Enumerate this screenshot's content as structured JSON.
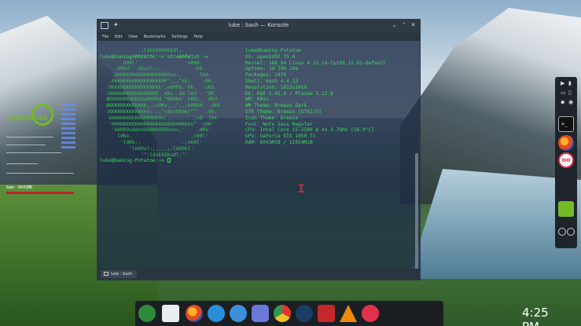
{
  "window": {
    "title": "luke : bash — Konsole",
    "menu": [
      "File",
      "Edit",
      "View",
      "Bookmarks",
      "Settings",
      "Help"
    ],
    "tab_label": "luke : bash"
  },
  "terminal": {
    "command_line": "luke@Gaming-Potatoe:~> screenfetch -w",
    "final_prompt": "luke@Gaming-Potatoe:~> ",
    "logo_lines": [
      "             .;ldkO0000Okdl;.",
      "         .;d00xl:^''''''^:ok00d;.",
      "       .d00l'                'o00d.",
      "     .d0Kd'  Okxol:;,.          :00.",
      "    .OKKKK0kOKKKKKKKKKKOxo:,      lKO.",
      "   ,0KKKKKKKKKKKKKKKK0P^,,,^dx:    ;00,",
      "  .OKKKKKKKKKKKKKKKKk'.oOPPb.'0k.   cKO.",
      "  :KKKKKKKKKKKKKKKKK: kKx..dd lKd   'OK:",
      "  dKKKKKKKKKKKOx0KKKd ^0KKKO' kKKc   dKd",
      "  dKKKKKKKKKKKKK;.;oOKx,,,^..;kKKK0.  dKd",
      "  :KKKKKKKKKKKK0o;...^cdxxOK0O/^^'  .0K:",
      "   kKKKKKKKKKKKKKKKK0x;,,......,;od  lKk",
      "   '0KKKKKKKKKKKKKKKKKKKKK00KKOo^  c00'",
      "    'kKKKOxddxkOO00000Okxoc;''   .dKk'",
      "      l0Ko.                    .c00l'",
      "       'l0Kk:.              .;xK0l'",
      "          'lkK0xl:;,,,,;:ldO0kl'",
      "              '^:ldxkkkkxdl:^'"
    ],
    "info": [
      {
        "key": "",
        "value": "luke@Gaming-Potatoe"
      },
      {
        "key": "OS:",
        "value": "openSUSE 15.0"
      },
      {
        "key": "Kernel:",
        "value": "x86_64 Linux 4.12.14-lp150.12.61-default"
      },
      {
        "key": "Uptime:",
        "value": "1d 19h 10m"
      },
      {
        "key": "Packages:",
        "value": "2870"
      },
      {
        "key": "Shell:",
        "value": "bash 4.4.23"
      },
      {
        "key": "Resolution:",
        "value": "1812x1019"
      },
      {
        "key": "DE:",
        "value": "KDE 5.45.0 / Plasma 5.12.8"
      },
      {
        "key": "WM:",
        "value": "KWin"
      },
      {
        "key": "WM Theme:",
        "value": "Breeze Dark"
      },
      {
        "key": "GTK Theme:",
        "value": "Breeze [GTK2/3]"
      },
      {
        "key": "Icon Theme:",
        "value": "breeze"
      },
      {
        "key": "Font:",
        "value": "Noto Sans Regular"
      },
      {
        "key": "CPU:",
        "value": "Intel Core i5-2500 @ 4x 3.7GHz [56.0°C]"
      },
      {
        "key": "GPU:",
        "value": "GeForce GTX 1050 Ti"
      },
      {
        "key": "RAM:",
        "value": "6043MiB / 11954MiB"
      }
    ]
  },
  "conky": {
    "brand": "openSUSE",
    "ram_label": "Ram: 6043MB"
  },
  "dock": {
    "clock": "4:25 PM",
    "icons": [
      "opensuse-icon",
      "files-icon",
      "firefox-icon",
      "discover-icon",
      "system-monitor-icon",
      "discord-icon",
      "chrome-icon",
      "steam-icon",
      "filezilla-icon",
      "vlc-icon",
      "pp-icon"
    ]
  },
  "colors": {
    "terminal_green": "#3ddc5c",
    "accent_suse": "#73ba25"
  }
}
